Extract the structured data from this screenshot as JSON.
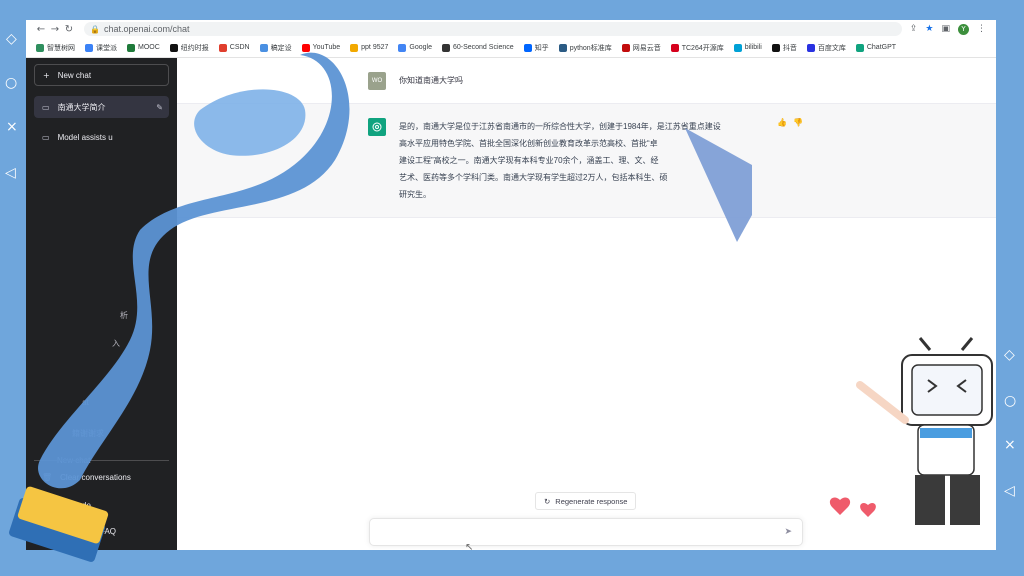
{
  "browser": {
    "url": "chat.openai.com/chat",
    "profile_initial": "Y"
  },
  "bookmarks": [
    {
      "label": "智慧树网",
      "color": "#2f8f5e"
    },
    {
      "label": "课堂派",
      "color": "#3b82f6"
    },
    {
      "label": "MOOC",
      "color": "#1f7a3a"
    },
    {
      "label": "纽约时报",
      "color": "#111111"
    },
    {
      "label": "CSDN",
      "color": "#e03e2d"
    },
    {
      "label": "稿定设",
      "color": "#4a90e2"
    },
    {
      "label": "YouTube",
      "color": "#ff0000"
    },
    {
      "label": "ppt 9527",
      "color": "#f2a900"
    },
    {
      "label": "Google",
      "color": "#4285f4"
    },
    {
      "label": "60-Second Science",
      "color": "#333333"
    },
    {
      "label": "知乎",
      "color": "#0066ff"
    },
    {
      "label": "python标准库",
      "color": "#2b5b84"
    },
    {
      "label": "网易云音",
      "color": "#c20c0c"
    },
    {
      "label": "TC264开源库",
      "color": "#d6001c"
    },
    {
      "label": "bilibili",
      "color": "#00a1d6"
    },
    {
      "label": "抖音",
      "color": "#111111"
    },
    {
      "label": "百度文库",
      "color": "#2932e1"
    },
    {
      "label": "ChatGPT",
      "color": "#10a37f"
    }
  ],
  "sidebar": {
    "new_chat": "New chat",
    "items": [
      {
        "label": "南通大学简介"
      },
      {
        "label": "Model assists u"
      }
    ],
    "partials": [
      "析",
      "入",
      "at",
      "籍谢谢求",
      "New chat"
    ],
    "clear": "Clear conversations",
    "mode": "de",
    "faq": "FAQ"
  },
  "conversation": {
    "user_avatar": "WO",
    "user_message": "你知道南通大学吗",
    "bot_lines": [
      "是的，南通大学是位于江苏省南通市的一所综合性大学，创建于1984年，是江苏省重点建设",
      "高水平应用特色学院、首批全国深化创新创业教育改革示范高校、首批“卓",
      "建设工程”高校之一。南通大学现有本科专业70余个，涵盖工、理、文、经",
      "艺术、医药等多个学科门类。南通大学现有学生超过2万人，包括本科生、硕",
      "研究生。"
    ],
    "regenerate": "Regenerate response"
  }
}
